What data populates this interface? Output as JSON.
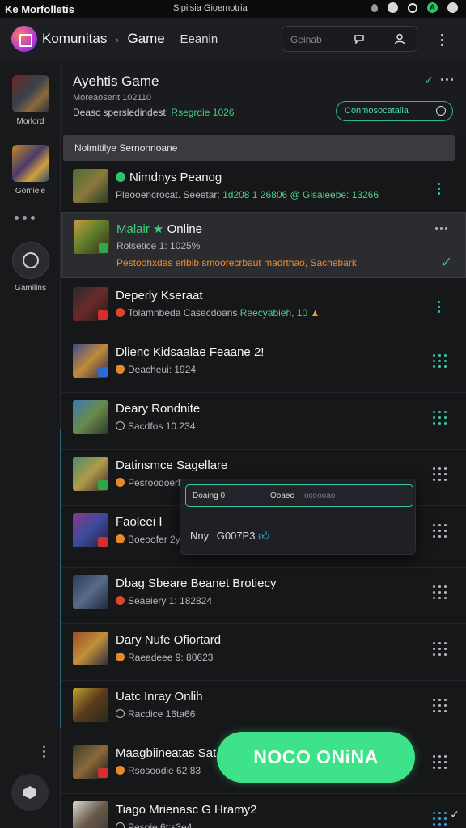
{
  "status_bar": {
    "left_text": "Ke Morfolletis",
    "center_text": "Sipilsia Gioemotria",
    "icons": [
      "location-icon",
      "chat-icon",
      "record-icon",
      "app-badge-icon"
    ],
    "badge_letter": "0",
    "app_badge_letter": "A"
  },
  "app_bar": {
    "title": "Komunitas",
    "separator": "›",
    "section": "Game",
    "subsection": "Eeanin",
    "search_placeholder": "Geinab"
  },
  "rail": {
    "items": [
      {
        "label": "Morlord"
      },
      {
        "label": "Gomiele"
      },
      {
        "label": "Gamilins"
      }
    ]
  },
  "header": {
    "title": "Ayehtis Game",
    "subtitle": "Moreaosent 102110",
    "stats_prefix": "Deasc spersledindest:",
    "stats_value": "Rsegrdie 1026",
    "pill_label": "Conmosocatalia"
  },
  "section_bar": {
    "label": "Nolmitilye Sernonnoane"
  },
  "games": [
    {
      "title": "Nimdnys Peanog",
      "meta_prefix": "Pleooencrocat. Seeetar:",
      "meta_value": "1d208 1 26806 @ Glsaleebe: 13266",
      "icon": "online-dot-icon"
    },
    {
      "title_highlight": "Malair",
      "title": "Online",
      "meta": "Rolsetice 1: 1025%",
      "meta3": "Pestoohxdas erlbib smoorecrbaut madrthao, Sachebark",
      "selected": true
    },
    {
      "title": "Deperly Kseraat",
      "meta_prefix": "Tolamnbeda Casecdoans",
      "meta_value": "Reecyabieh, 10",
      "icon": "fire-icon"
    },
    {
      "title": "Dlienc Kidsaalae Feaane 2!",
      "meta": "Deacheui: 1924",
      "icon": "coin-icon"
    },
    {
      "title": "Deary Rondnite",
      "meta": "Sacdfos 10.234",
      "icon": "clock-icon"
    },
    {
      "title": "Datinsmce Sagellare",
      "meta": "Pesroodoerle Arentlan Deng",
      "icon": "coin-icon"
    },
    {
      "title": "Faoleei I",
      "meta": "Boeoofer 2y",
      "icon": "coin-icon"
    },
    {
      "title": "Dbag Sbeare Beanet Brotiecy",
      "meta": "Seaeiery 1: 182824",
      "icon": "target-icon"
    },
    {
      "title": "Dary Nufe Ofiortard",
      "meta": "Raeadeee 9: 80623",
      "icon": "coin-icon"
    },
    {
      "title": "Uatc Inray Onlih",
      "meta": "Racdice 16ta66",
      "icon": "clock-icon"
    },
    {
      "title": "Maagbiineatas Sat B",
      "meta": "Rsosoodie 62 83",
      "icon": "coin-icon"
    },
    {
      "title": "Tiago Mrienasc G Hramy2",
      "meta": "Pesoie 6t:s3e4",
      "icon": "clock-icon"
    }
  ],
  "popup": {
    "field_a": "Doaing 0",
    "field_b": "Ooaec",
    "field_c": "ocoooao",
    "line_label": "Nny",
    "line_value": "G007P3"
  },
  "fab": {
    "label": "NOCO ONiNA"
  },
  "colors": {
    "accent_green": "#3ee28a",
    "accent_teal": "#38c7b0",
    "warning_orange": "#f08a2b",
    "background": "#161719"
  }
}
